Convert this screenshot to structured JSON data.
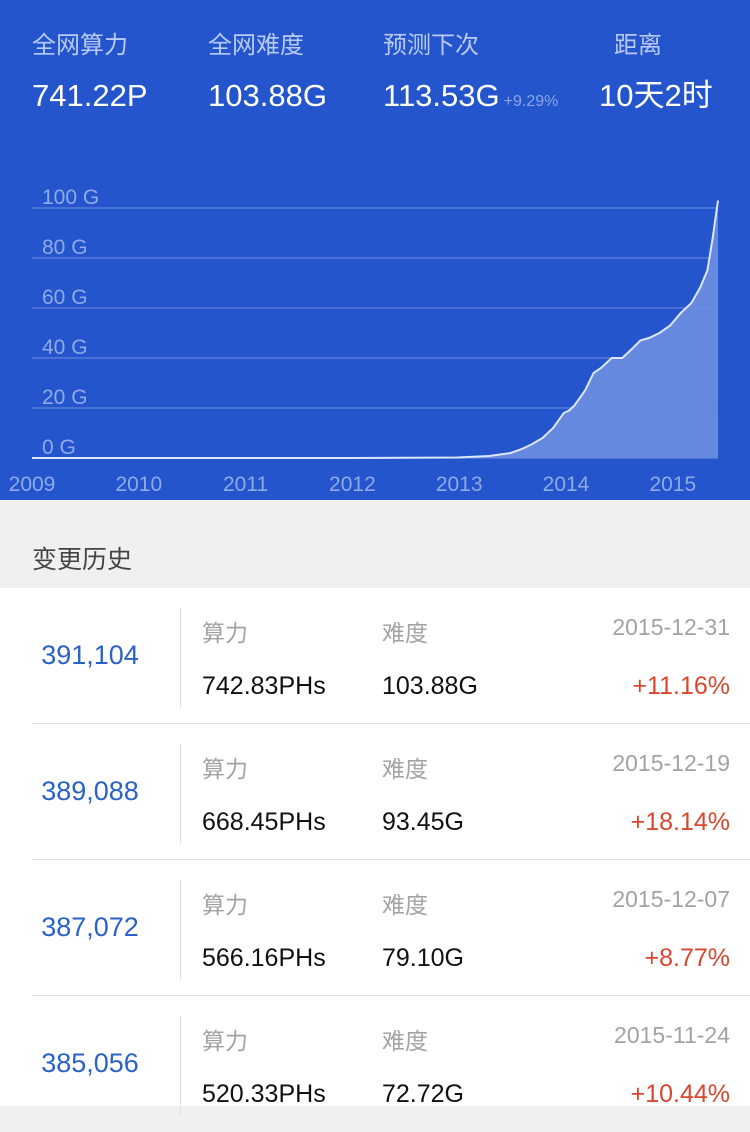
{
  "header": {
    "stats": [
      {
        "label": "全网算力",
        "value": "741.22P",
        "change": ""
      },
      {
        "label": "全网难度",
        "value": "103.88G",
        "change": ""
      },
      {
        "label": "预测下次",
        "value": "113.53G",
        "change": "+9.29%"
      },
      {
        "label": "距离",
        "value": "10天2时",
        "change": ""
      }
    ]
  },
  "chart_data": {
    "type": "area",
    "title": "",
    "xlabel": "",
    "ylabel": "",
    "x_ticks": [
      "2009",
      "2010",
      "2011",
      "2012",
      "2013",
      "2014",
      "2015"
    ],
    "y_ticks": [
      "0 G",
      "20 G",
      "40 G",
      "60 G",
      "80 G",
      "100 G"
    ],
    "ylim": [
      0,
      100
    ],
    "xlim": [
      2009.0,
      2015.45
    ],
    "grid": true,
    "legend": "none",
    "colors": {
      "line": "#dde6fa",
      "fill": "#6b8fe0",
      "grid": "#6f90de",
      "tick": "#8eaae8"
    },
    "x": [
      2009.0,
      2012.0,
      2013.0,
      2013.3,
      2013.5,
      2013.6,
      2013.7,
      2013.8,
      2013.9,
      2014.0,
      2014.05,
      2014.1,
      2014.2,
      2014.28,
      2014.35,
      2014.4,
      2014.45,
      2014.55,
      2014.65,
      2014.72,
      2014.8,
      2014.9,
      2015.0,
      2015.1,
      2015.2,
      2015.28,
      2015.35,
      2015.4,
      2015.45
    ],
    "y": [
      0,
      0,
      0.2,
      0.8,
      2,
      3.5,
      5.5,
      8,
      12,
      18,
      19,
      21,
      27,
      34,
      36,
      38,
      40,
      40,
      44,
      47,
      48,
      50,
      53,
      58,
      62,
      68,
      75,
      88,
      103
    ]
  },
  "history": {
    "title": "变更历史",
    "rows": [
      {
        "height": "391,104",
        "hash_label": "算力",
        "hash": "742.83PHs",
        "diff_label": "难度",
        "diff": "103.88G",
        "date": "2015-12-31",
        "change": "+11.16%"
      },
      {
        "height": "389,088",
        "hash_label": "算力",
        "hash": "668.45PHs",
        "diff_label": "难度",
        "diff": "93.45G",
        "date": "2015-12-19",
        "change": "+18.14%"
      },
      {
        "height": "387,072",
        "hash_label": "算力",
        "hash": "566.16PHs",
        "diff_label": "难度",
        "diff": "79.10G",
        "date": "2015-12-07",
        "change": "+8.77%"
      },
      {
        "height": "385,056",
        "hash_label": "算力",
        "hash": "520.33PHs",
        "diff_label": "难度",
        "diff": "72.72G",
        "date": "2015-11-24",
        "change": "+10.44%"
      }
    ]
  }
}
